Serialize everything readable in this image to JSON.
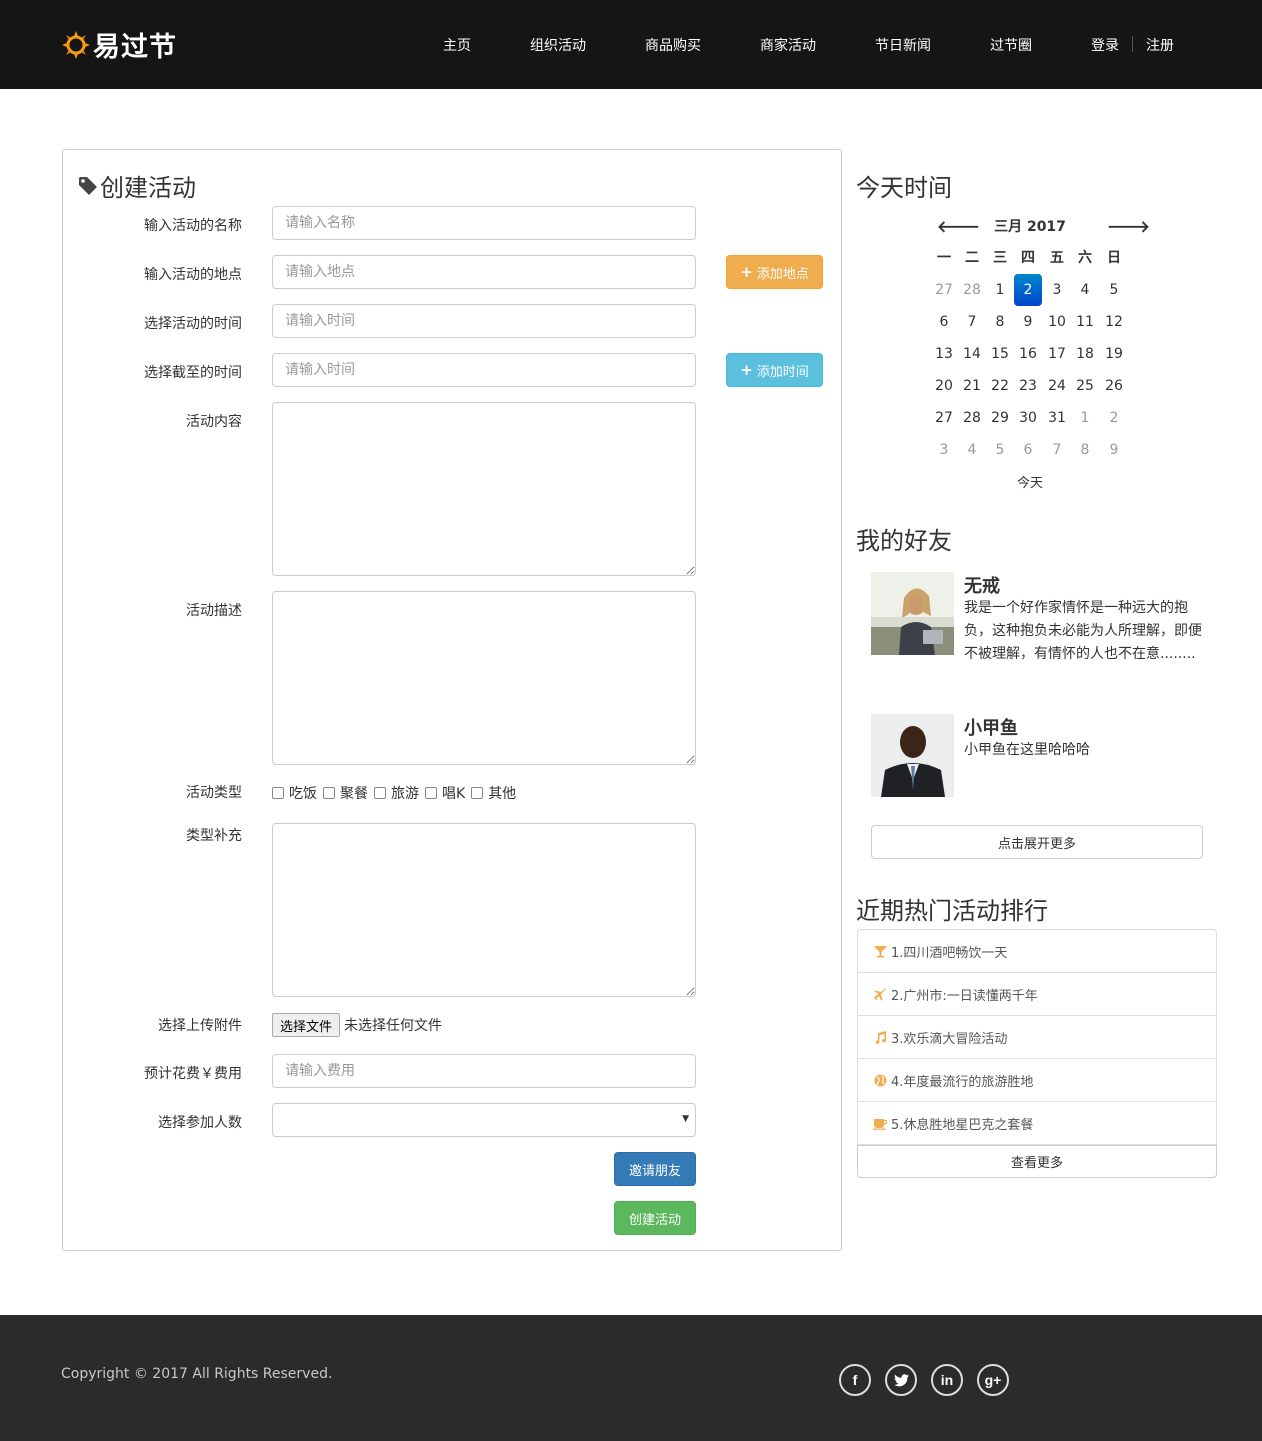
{
  "brand": {
    "name": "易过节",
    "accent": "#f39c12"
  },
  "nav": {
    "items": [
      "主页",
      "组织活动",
      "商品购买",
      "商家活动",
      "节日新闻",
      "过节圈"
    ],
    "login": "登录",
    "register": "注册"
  },
  "form": {
    "title": "创建活动",
    "name_label": "输入活动的名称",
    "name_placeholder": "请输入名称",
    "place_label": "输入活动的地点",
    "place_placeholder": "请输入地点",
    "add_place_button": "添加地点",
    "start_label": "选择活动的时间",
    "start_placeholder": "请输入时间",
    "end_label": "选择截至的时间",
    "end_placeholder": "请输入时间",
    "add_time_button": "添加时间",
    "content_label": "活动内容",
    "desc_label": "活动描述",
    "type_label": "活动类型",
    "types": [
      "吃饭",
      "聚餐",
      "旅游",
      "唱K",
      "其他"
    ],
    "type_extra_label": "类型补充",
    "upload_label": "选择上传附件",
    "file_button": "选择文件",
    "file_status": "未选择任何文件",
    "cost_label": "预计花费￥费用",
    "cost_placeholder": "请输入费用",
    "people_label": "选择参加人数",
    "people_value": "",
    "invite_button": "邀请朋友",
    "create_button": "创建活动"
  },
  "calendar": {
    "heading": "今天时间",
    "title": "三月 2017",
    "weekdays": [
      "一",
      "二",
      "三",
      "四",
      "五",
      "六",
      "日"
    ],
    "weeks": [
      [
        "27",
        "28",
        "1",
        "2",
        "3",
        "4",
        "5"
      ],
      [
        "6",
        "7",
        "8",
        "9",
        "10",
        "11",
        "12"
      ],
      [
        "13",
        "14",
        "15",
        "16",
        "17",
        "18",
        "19"
      ],
      [
        "20",
        "21",
        "22",
        "23",
        "24",
        "25",
        "26"
      ],
      [
        "27",
        "28",
        "29",
        "30",
        "31",
        "1",
        "2"
      ],
      [
        "3",
        "4",
        "5",
        "6",
        "7",
        "8",
        "9"
      ]
    ],
    "today_button": "今天"
  },
  "friends": {
    "heading": "我的好友",
    "list": [
      {
        "name": "无戒",
        "desc": "我是一个好作家情怀是一种远大的抱负，这种抱负未必能为人所理解，即便不被理解，有情怀的人也不在意........"
      },
      {
        "name": "小甲鱼",
        "desc": "小甲鱼在这里哈哈哈"
      }
    ],
    "more_button": "点击展开更多"
  },
  "hot": {
    "heading": "近期热门活动排行",
    "items": [
      {
        "icon": "cocktail-icon",
        "text": "1.四川酒吧畅饮一天"
      },
      {
        "icon": "plane-icon",
        "text": "2.广州市:一日读懂两千年"
      },
      {
        "icon": "music-icon",
        "text": "3.欢乐滴大冒险活动"
      },
      {
        "icon": "globe-icon",
        "text": "4.年度最流行的旅游胜地"
      },
      {
        "icon": "coffee-icon",
        "text": "5.休息胜地星巴克之套餐"
      }
    ],
    "more_button": "查看更多"
  },
  "footer": {
    "copyright": "Copyright © 2017 All Rights Reserved.",
    "social": [
      "facebook-icon",
      "twitter-icon",
      "linkedin-icon",
      "google-plus-icon"
    ]
  }
}
